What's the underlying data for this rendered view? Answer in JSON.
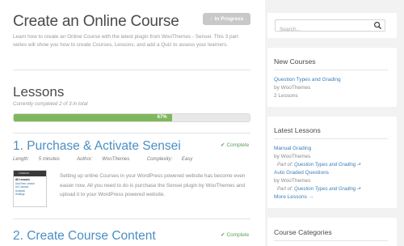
{
  "course": {
    "title": "Create an Online Course",
    "status_label": "In Progress",
    "description": "Learn how to create an Online Course with the latest plugin from WooThemes - Sensei. This 3 part series will show you how to create Courses, Lessons, and add a Quiz to assess your learners."
  },
  "lessons_section": {
    "heading": "Lessons",
    "progress_text": "Currently completed 2 of 3 in total",
    "progress_percent": 67,
    "progress_label": "67%"
  },
  "lessons": [
    {
      "title": "1. Purchase & Activate Sensei",
      "status": "Complete",
      "length_label": "Length:",
      "length_value": "5 minutes",
      "author_label": "Author:",
      "author_value": "WooThemes",
      "complexity_label": "Complexity:",
      "complexity_value": "Easy",
      "excerpt": "Setting up online Courses in your WordPress powered website has become even easier now. All you need to do is purchase the Sensei plugin by WooThemes and upload it to your WordPress powered website.",
      "thumbnail": {
        "bar_label": "Lessons",
        "items": [
          "All Lessons",
          "Add New Lesson",
          "All Courses",
          "Analysis",
          "Settings"
        ]
      }
    },
    {
      "title": "2. Create Course Content",
      "status": "Complete"
    }
  ],
  "sidebar": {
    "search": {
      "placeholder": "Search..."
    },
    "new_courses": {
      "title": "New Courses",
      "course_title": "Question Types and Grading",
      "byline": "by WooThemes",
      "lesson_count": "2 Lessons"
    },
    "latest_lessons": {
      "title": "Latest Lessons",
      "items": [
        {
          "title": "Manual Grading",
          "byline": "by WooThemes",
          "part_of_label": "Part of:",
          "part_of_link": "Question Types and Grading"
        },
        {
          "title": "Auto Graded Questions",
          "byline": "by WooThemes",
          "part_of_label": "Part of:",
          "part_of_link": "Question Types and Grading"
        }
      ],
      "more_link": "More Lessons →"
    },
    "course_categories": {
      "title": "Course Categories"
    }
  },
  "colors": {
    "link": "#3b7fb8",
    "lesson_title": "#4a8fc4",
    "complete": "#5aa05a",
    "progress": "#7fb85c",
    "status_button": "#c8c8c8",
    "sidebar_bg": "#f2f2f2"
  }
}
